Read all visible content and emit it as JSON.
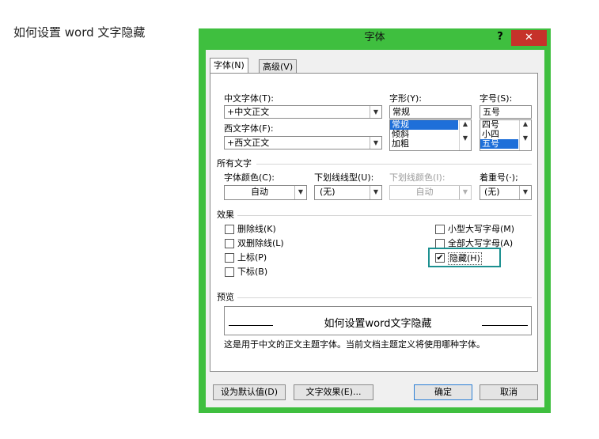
{
  "caption": "如何设置 word 文字隐藏",
  "dialog": {
    "title": "字体",
    "help": "?",
    "close": "✕",
    "tabs": [
      "字体(N)",
      "高级(V)"
    ],
    "font": {
      "cn_font_label": "中文字体(T):",
      "cn_font_value": "+中文正文",
      "west_font_label": "西文字体(F):",
      "west_font_value": "+西文正文",
      "style_label": "字形(Y):",
      "style_value": "常规",
      "style_options": [
        "常规",
        "倾斜",
        "加粗"
      ],
      "size_label": "字号(S):",
      "size_value": "五号",
      "size_options": [
        "四号",
        "小四",
        "五号"
      ]
    },
    "all_text": {
      "section": "所有文字",
      "color_label": "字体颜色(C):",
      "color_value": "自动",
      "underline_label": "下划线线型(U):",
      "underline_value": "(无)",
      "underline_color_label": "下划线颜色(I):",
      "underline_color_value": "自动",
      "emphasis_label": "着重号(·);",
      "emphasis_value": "(无)"
    },
    "effects": {
      "section": "效果",
      "strikethrough": "删除线(K)",
      "double_strike": "双删除线(L)",
      "superscript": "上标(P)",
      "subscript": "下标(B)",
      "small_caps": "小型大写字母(M)",
      "all_caps": "全部大写字母(A)",
      "hidden": "隐藏(H)",
      "hidden_checked": "✔"
    },
    "preview": {
      "section": "预览",
      "text": "如何设置word文字隐藏",
      "note": "这是用于中文的正文主题字体。当前文档主题定义将使用哪种字体。"
    },
    "buttons": {
      "set_default": "设为默认值(D)",
      "text_effects": "文字效果(E)...",
      "ok": "确定",
      "cancel": "取消"
    }
  }
}
